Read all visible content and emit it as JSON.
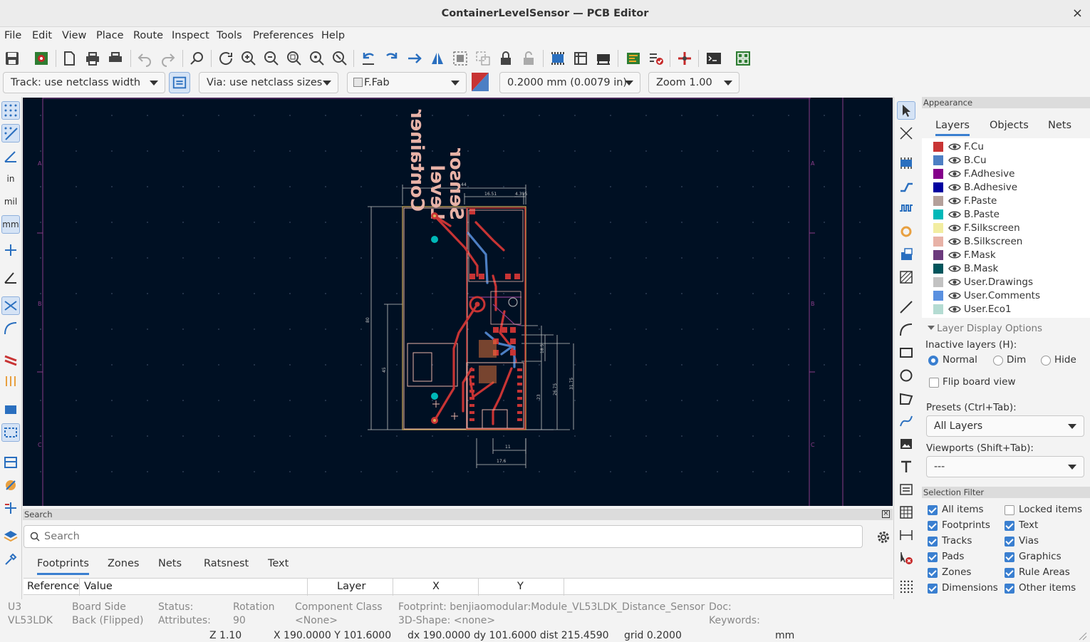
{
  "window": {
    "title": "ContainerLevelSensor — PCB Editor",
    "close": "×"
  },
  "menu": [
    "File",
    "Edit",
    "View",
    "Place",
    "Route",
    "Inspect",
    "Tools",
    "Preferences",
    "Help"
  ],
  "auxbar": {
    "track": "Track: use netclass width",
    "via": "Via: use netclass sizes",
    "layer": "F.Fab",
    "grid": "0.2000 mm (0.0079 in)",
    "zoom": "Zoom 1.00"
  },
  "left_toolbar": {
    "in": "in",
    "mil": "mil",
    "mm": "mm"
  },
  "appearance": {
    "header": "Appearance",
    "tabs": [
      "Layers",
      "Objects",
      "Nets"
    ],
    "layers": [
      {
        "name": "F.Cu",
        "color": "#c83434"
      },
      {
        "name": "B.Cu",
        "color": "#4d7fc4"
      },
      {
        "name": "F.Adhesive",
        "color": "#84008a"
      },
      {
        "name": "B.Adhesive",
        "color": "#0000a0"
      },
      {
        "name": "F.Paste",
        "color": "#b4a09a"
      },
      {
        "name": "B.Paste",
        "color": "#00b8b8"
      },
      {
        "name": "F.Silkscreen",
        "color": "#f2eda1"
      },
      {
        "name": "B.Silkscreen",
        "color": "#e8b2a7"
      },
      {
        "name": "F.Mask",
        "color": "#6b3a7c"
      },
      {
        "name": "B.Mask",
        "color": "#02555c"
      },
      {
        "name": "User.Drawings",
        "color": "#c2c2c2"
      },
      {
        "name": "User.Comments",
        "color": "#5990e0"
      },
      {
        "name": "User.Eco1",
        "color": "#b4dbd2"
      }
    ],
    "display_options": "Layer Display Options",
    "inactive_label": "Inactive layers (H):",
    "inactive_options": [
      "Normal",
      "Dim",
      "Hide"
    ],
    "flip_board": "Flip board view",
    "presets_label": "Presets (Ctrl+Tab):",
    "presets_value": "All Layers",
    "viewports_label": "Viewports (Shift+Tab):",
    "viewports_value": "---"
  },
  "selection_filter": {
    "header": "Selection Filter",
    "items": [
      {
        "label": "All items",
        "checked": true
      },
      {
        "label": "Locked items",
        "checked": false
      },
      {
        "label": "Footprints",
        "checked": true
      },
      {
        "label": "Text",
        "checked": true
      },
      {
        "label": "Tracks",
        "checked": true
      },
      {
        "label": "Vias",
        "checked": true
      },
      {
        "label": "Pads",
        "checked": true
      },
      {
        "label": "Graphics",
        "checked": true
      },
      {
        "label": "Zones",
        "checked": true
      },
      {
        "label": "Rule Areas",
        "checked": true
      },
      {
        "label": "Dimensions",
        "checked": true
      },
      {
        "label": "Other items",
        "checked": true
      }
    ]
  },
  "search": {
    "header": "Search",
    "placeholder": "Search",
    "tabs": [
      "Footprints",
      "Zones",
      "Nets",
      "Ratsnest",
      "Text"
    ],
    "columns": [
      "Reference",
      "Value",
      "Layer",
      "X",
      "Y"
    ]
  },
  "canvas": {
    "border_labels": [
      "A",
      "B",
      "C"
    ],
    "silk_text": [
      "Container",
      "Level",
      "Sensor"
    ],
    "dimensions": [
      "44",
      "16.51",
      "4.395",
      "80",
      "45",
      "23",
      "26.75",
      "31.75",
      "18.5",
      "11",
      "17.6"
    ]
  },
  "info": {
    "ref": "U3",
    "value": "VL53LDK",
    "board_side_label": "Board Side",
    "board_side_value": "Back (Flipped)",
    "status_label": "Status:",
    "attributes_label": "Attributes:",
    "rotation_label": "Rotation",
    "rotation_value": "90",
    "component_class_label": "Component Class",
    "component_class_value": "<None>",
    "footprint": "Footprint: benjiaomodular:Module_VL53LDK_Distance_Sensor",
    "shape": "3D-Shape: <none>",
    "doc": "Doc:",
    "keywords": "Keywords:"
  },
  "status": {
    "zoom": "Z 1.10",
    "xy": "X 190.0000  Y 101.6000",
    "delta": "dx 190.0000  dy 101.6000  dist 215.4590",
    "grid": "grid 0.2000",
    "units": "mm"
  }
}
